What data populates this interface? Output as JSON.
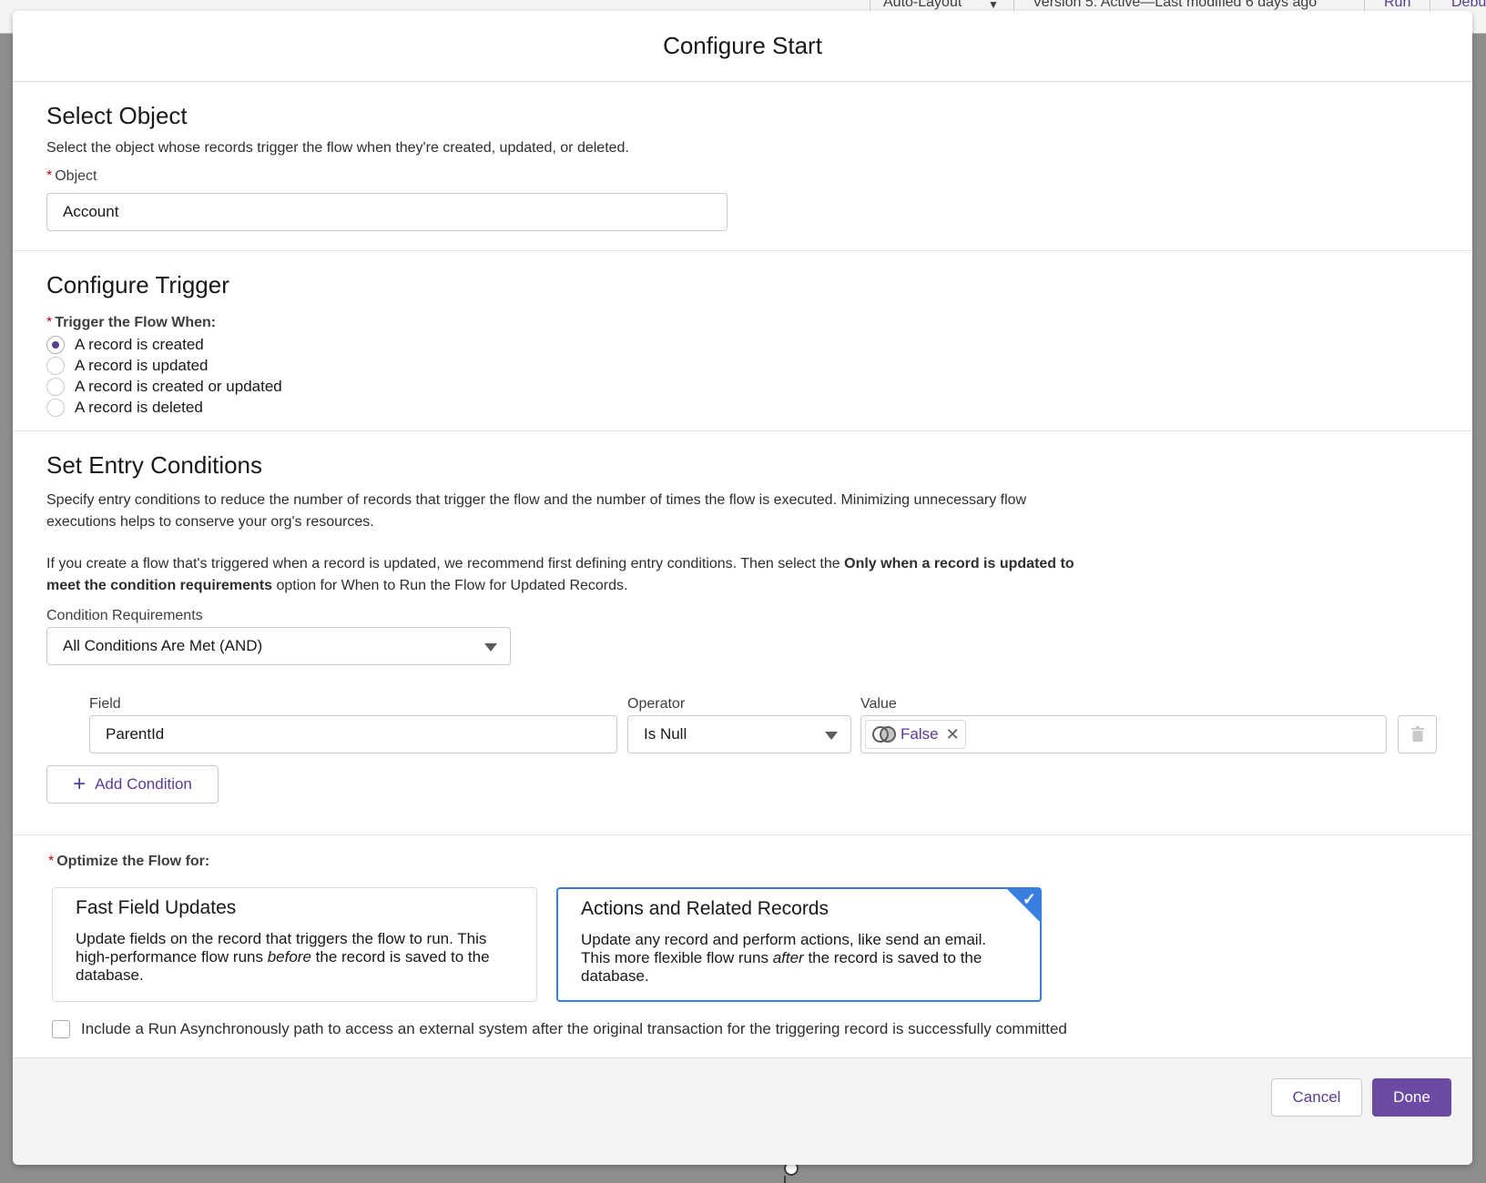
{
  "background": {
    "layout_mode": "Auto-Layout",
    "version_text": "Version 5: Active—Last modified 6 days ago",
    "run_label": "Run",
    "debug_label": "Debu"
  },
  "modal": {
    "title": "Configure Start"
  },
  "select_object": {
    "title": "Select Object",
    "description": "Select the object whose records trigger the flow when they're created, updated, or deleted.",
    "object_label": "Object",
    "object_value": "Account"
  },
  "configure_trigger": {
    "title": "Configure Trigger",
    "trigger_label": "Trigger the Flow When:",
    "options": [
      {
        "label": "A record is created",
        "checked": true
      },
      {
        "label": "A record is updated",
        "checked": false
      },
      {
        "label": "A record is created or updated",
        "checked": false
      },
      {
        "label": "A record is deleted",
        "checked": false
      }
    ]
  },
  "entry_conditions": {
    "title": "Set Entry Conditions",
    "description": "Specify entry conditions to reduce the number of records that trigger the flow and the number of times the flow is executed. Minimizing unnecessary flow executions helps to conserve your org's resources.",
    "note_pre": "If you create a flow that's triggered when a record is updated, we recommend first defining entry conditions. Then select the ",
    "note_bold": "Only when a record is updated to meet the condition requirements",
    "note_post": " option for When to Run the Flow for Updated Records.",
    "requirements_label": "Condition Requirements",
    "requirements_value": "All Conditions Are Met (AND)",
    "columns": {
      "field": "Field",
      "operator": "Operator",
      "value": "Value"
    },
    "condition": {
      "field": "ParentId",
      "operator": "Is Null",
      "value": "False"
    },
    "add_condition_label": "Add Condition"
  },
  "optimize": {
    "label": "Optimize the Flow for:",
    "cards": [
      {
        "title": "Fast Field Updates",
        "desc_pre": "Update fields on the record that triggers the flow to run. This high-performance flow runs ",
        "desc_em": "before",
        "desc_post": " the record is saved to the database.",
        "selected": false
      },
      {
        "title": "Actions and Related Records",
        "desc_pre": "Update any record and perform actions, like send an email. This more flexible flow runs ",
        "desc_em": "after",
        "desc_post": " the record is saved to the database.",
        "selected": true
      }
    ],
    "async_label": "Include a Run Asynchronously path to access an external system after the original transaction for the triggering record is successfully committed",
    "async_checked": false
  },
  "footer": {
    "cancel_label": "Cancel",
    "done_label": "Done"
  },
  "colors": {
    "brand": "#6b4aa3",
    "selected_border": "#3a7fe0",
    "required": "#ba0517"
  }
}
